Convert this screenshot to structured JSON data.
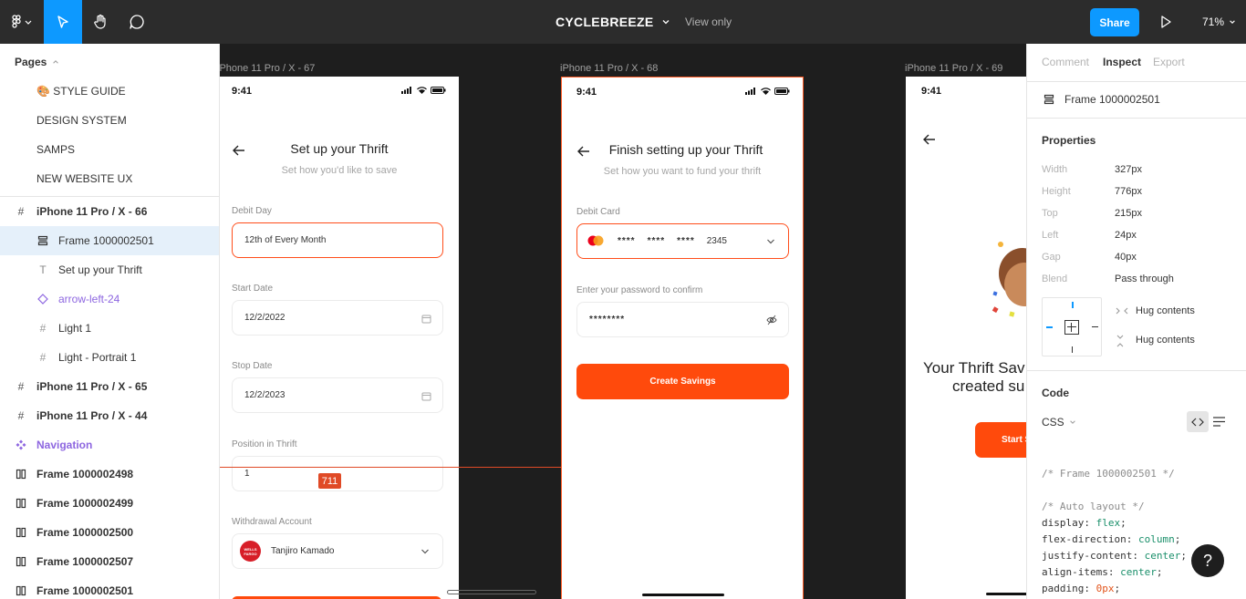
{
  "topbar": {
    "file_title": "CYCLEBREEZE",
    "view_mode": "View only",
    "share_label": "Share",
    "zoom_level": "71%"
  },
  "left_panel": {
    "pages_header": "Pages",
    "pages": [
      "🎨 STYLE GUIDE",
      "DESIGN SYSTEM",
      "SAMPS",
      "NEW WEBSITE UX"
    ],
    "layers": [
      {
        "label": "iPhone 11 Pro / X - 66",
        "icon": "frame-hash-icon"
      },
      {
        "label": "Frame 1000002501",
        "icon": "autolayout-icon"
      },
      {
        "label": "Set up your Thrift",
        "icon": "text-icon"
      },
      {
        "label": "arrow-left-24",
        "icon": "component-instance-icon"
      },
      {
        "label": "Light 1",
        "icon": "frame-hash-icon"
      },
      {
        "label": "Light - Portrait 1",
        "icon": "frame-hash-icon"
      },
      {
        "label": "iPhone 11 Pro / X - 65",
        "icon": "frame-hash-icon"
      },
      {
        "label": "iPhone 11 Pro / X - 44",
        "icon": "frame-hash-icon"
      },
      {
        "label": "Navigation",
        "icon": "component-icon"
      },
      {
        "label": "Frame 1000002498",
        "icon": "columns-icon"
      },
      {
        "label": "Frame 1000002499",
        "icon": "columns-icon"
      },
      {
        "label": "Frame 1000002500",
        "icon": "columns-icon"
      },
      {
        "label": "Frame 1000002507",
        "icon": "columns-icon"
      },
      {
        "label": "Frame 1000002501",
        "icon": "columns-icon"
      }
    ]
  },
  "canvas": {
    "frame_labels": [
      "iPhone 11 Pro / X - 67",
      "iPhone 11 Pro / X - 68",
      "iPhone 11 Pro / X - 69"
    ],
    "status_time": "9:41",
    "measure_badge": "711",
    "screen1": {
      "title": "Set up your Thrift",
      "subtitle": "Set how you'd like to save",
      "debit_day_label": "Debit Day",
      "debit_day_value": "12th of Every Month",
      "start_label": "Start Date",
      "start_value": "12/2/2022",
      "stop_label": "Stop Date",
      "stop_value": "12/2/2023",
      "position_label": "Position in Thrift",
      "position_value": "1",
      "withdrawal_label": "Withdrawal Account",
      "account_name": "Tanjiro Kamado",
      "bank_badge": "WELLS FARGO"
    },
    "screen2": {
      "title": "Finish setting up your Thrift",
      "subtitle": "Set how you want to fund your thrift",
      "card_label": "Debit Card",
      "card_groups": [
        "****",
        "****",
        "****"
      ],
      "card_last4": "2345",
      "password_label": "Enter your password to confirm",
      "password_value": "********",
      "cta": "Create Savings"
    },
    "screen3": {
      "headline_line1": "Your Thrift Sav",
      "headline_line2": "created su",
      "cta": "Start S"
    }
  },
  "right_panel": {
    "tabs": [
      "Comment",
      "Inspect",
      "Export"
    ],
    "active_tab": "Inspect",
    "selection_name": "Frame 1000002501",
    "properties_title": "Properties",
    "properties": [
      {
        "k": "Width",
        "v": "327px"
      },
      {
        "k": "Height",
        "v": "776px"
      },
      {
        "k": "Top",
        "v": "215px"
      },
      {
        "k": "Left",
        "v": "24px"
      },
      {
        "k": "Gap",
        "v": "40px"
      },
      {
        "k": "Blend",
        "v": "Pass through"
      }
    ],
    "hug_h": "Hug contents",
    "hug_v": "Hug contents",
    "code_title": "Code",
    "code_lang": "CSS",
    "code_lines": {
      "c1": "/* Frame 1000002501 */",
      "c2": "/* Auto layout */",
      "l1k": "display: ",
      "l1v": "flex",
      "l2k": "flex-direction: ",
      "l2v": "column",
      "l3k": "justify-content: ",
      "l3v": "center",
      "l4k": "align-items: ",
      "l4v": "center",
      "l5k": "padding: ",
      "l5v": "0px"
    }
  },
  "help_label": "?",
  "colors": {
    "accent": "#0d99ff",
    "brand_orange": "#ff4a0c",
    "selection": "#e5f0fa"
  }
}
